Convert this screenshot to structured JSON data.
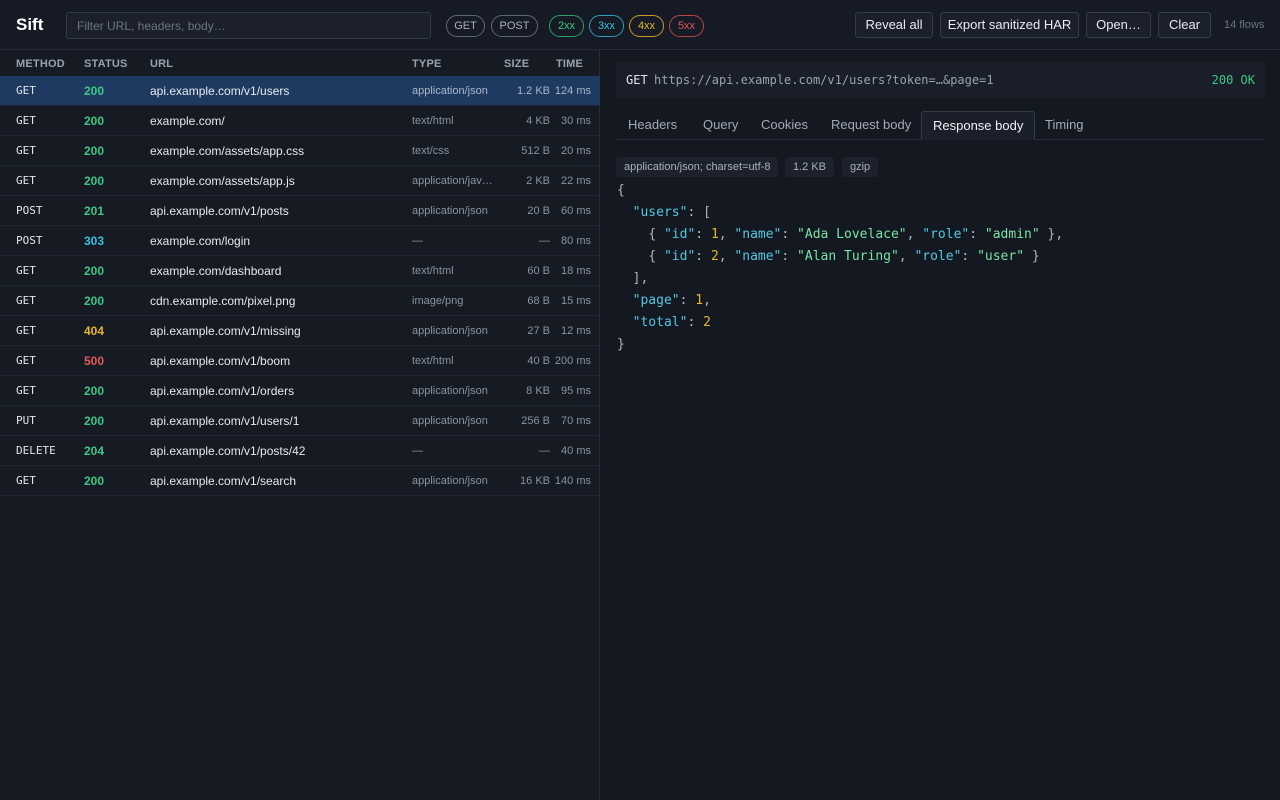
{
  "app": {
    "title": "Sift"
  },
  "filter": {
    "placeholder": "Filter URL, headers, body…",
    "value": ""
  },
  "method_filters": [
    "GET",
    "POST"
  ],
  "status_filters": [
    "2xx",
    "3xx",
    "4xx",
    "5xx"
  ],
  "toolbar": {
    "reveal_all": "Reveal all",
    "export_har": "Export sanitized HAR",
    "open": "Open…",
    "clear": "Clear",
    "flow_count": "14 flows"
  },
  "columns": {
    "method": "METHOD",
    "status": "STATUS",
    "url": "URL",
    "type": "TYPE",
    "size": "SIZE",
    "time": "TIME"
  },
  "flows": [
    {
      "method": "GET",
      "status": "200",
      "url": "api.example.com/v1/users",
      "type": "application/json",
      "size": "1.2 KB",
      "time": "124 ms"
    },
    {
      "method": "GET",
      "status": "200",
      "url": "example.com/",
      "type": "text/html",
      "size": "4 KB",
      "time": "30 ms"
    },
    {
      "method": "GET",
      "status": "200",
      "url": "example.com/assets/app.css",
      "type": "text/css",
      "size": "512 B",
      "time": "20 ms"
    },
    {
      "method": "GET",
      "status": "200",
      "url": "example.com/assets/app.js",
      "type": "application/java…",
      "size": "2 KB",
      "time": "22 ms"
    },
    {
      "method": "POST",
      "status": "201",
      "url": "api.example.com/v1/posts",
      "type": "application/json",
      "size": "20 B",
      "time": "60 ms"
    },
    {
      "method": "POST",
      "status": "303",
      "url": "example.com/login",
      "type": "—",
      "size": "—",
      "time": "80 ms"
    },
    {
      "method": "GET",
      "status": "200",
      "url": "example.com/dashboard",
      "type": "text/html",
      "size": "60 B",
      "time": "18 ms"
    },
    {
      "method": "GET",
      "status": "200",
      "url": "cdn.example.com/pixel.png",
      "type": "image/png",
      "size": "68 B",
      "time": "15 ms"
    },
    {
      "method": "GET",
      "status": "404",
      "url": "api.example.com/v1/missing",
      "type": "application/json",
      "size": "27 B",
      "time": "12 ms"
    },
    {
      "method": "GET",
      "status": "500",
      "url": "api.example.com/v1/boom",
      "type": "text/html",
      "size": "40 B",
      "time": "200 ms"
    },
    {
      "method": "GET",
      "status": "200",
      "url": "api.example.com/v1/orders",
      "type": "application/json",
      "size": "8 KB",
      "time": "95 ms"
    },
    {
      "method": "PUT",
      "status": "200",
      "url": "api.example.com/v1/users/1",
      "type": "application/json",
      "size": "256 B",
      "time": "70 ms"
    },
    {
      "method": "DELETE",
      "status": "204",
      "url": "api.example.com/v1/posts/42",
      "type": "—",
      "size": "—",
      "time": "40 ms"
    },
    {
      "method": "GET",
      "status": "200",
      "url": "api.example.com/v1/search",
      "type": "application/json",
      "size": "16 KB",
      "time": "140 ms"
    }
  ],
  "detail": {
    "method": "GET",
    "url": "https://api.example.com/v1/users?token=…&page=1",
    "status": "200 OK",
    "tabs": [
      "Headers",
      "Query",
      "Cookies",
      "Request body",
      "Response body",
      "Timing"
    ],
    "active_tab": "Response body",
    "meta": [
      "application/json; charset=utf-8",
      "1.2 KB",
      "gzip"
    ],
    "body_lines": [
      "{",
      "  \"users\": [",
      "    { \"id\": 1, \"name\": \"Ada Lovelace\", \"role\": \"admin\" },",
      "    { \"id\": 2, \"name\": \"Alan Turing\", \"role\": \"user\" }",
      "  ],",
      "  \"page\": 1,",
      "  \"total\": 2",
      "}"
    ]
  },
  "colors": {
    "status_2xx": "#3ec784",
    "status_3xx": "#3cc1de",
    "status_4xx": "#e5b532",
    "status_5xx": "#e05959",
    "selected_row": "#1f3a60"
  }
}
